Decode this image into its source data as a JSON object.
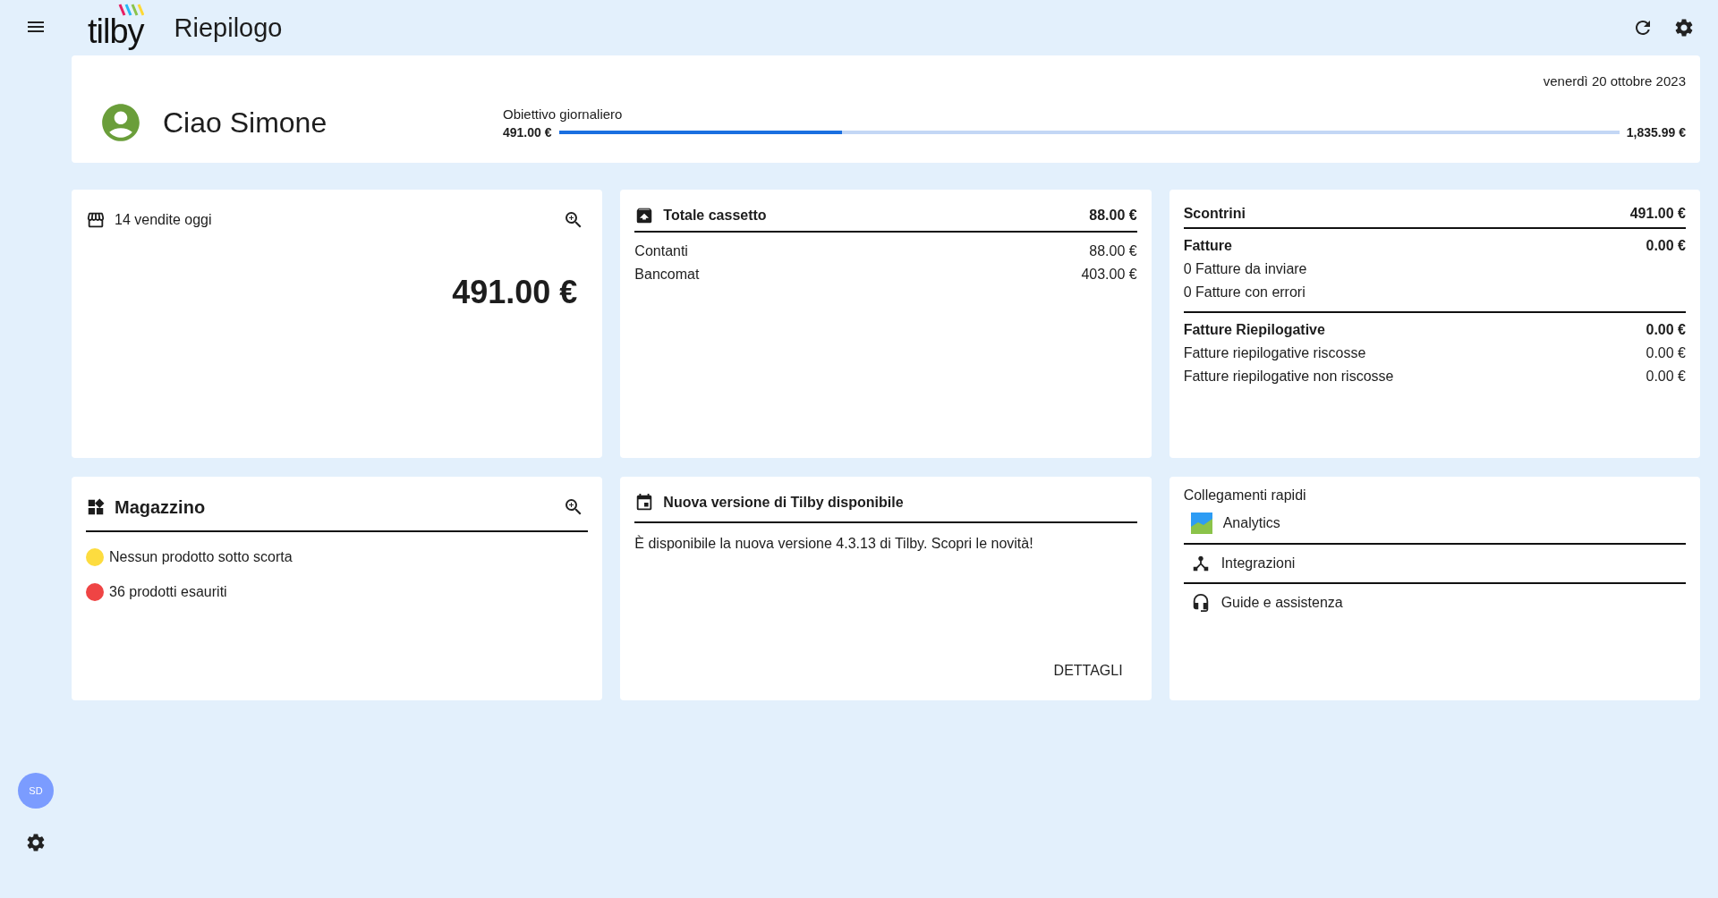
{
  "sidebar": {
    "avatar_initials": "SD"
  },
  "header": {
    "logo": "tilby",
    "title": "Riepilogo"
  },
  "greeting": {
    "date": "venerdì 20 ottobre 2023",
    "text": "Ciao Simone",
    "goal": {
      "label": "Obiettivo giornaliero",
      "current": "491.00 €",
      "target": "1,835.99 €",
      "level": 0.267
    }
  },
  "sales_card": {
    "title": "14 vendite oggi",
    "total": "491.00 €"
  },
  "drawer_card": {
    "title": "Totale cassetto",
    "total": "88.00 €",
    "rows": [
      {
        "label": "Contanti",
        "value": "88.00 €"
      },
      {
        "label": "Bancomat",
        "value": "403.00 €"
      }
    ]
  },
  "documents_card": {
    "sections": [
      {
        "title": "Scontrini",
        "total": "491.00 €"
      },
      {
        "title": "Fatture",
        "total": "0.00 €",
        "rows": [
          {
            "label": "0 Fatture da inviare"
          },
          {
            "label": "0 Fatture con errori"
          }
        ]
      },
      {
        "title": "Fatture Riepilogative",
        "total": "0.00 €",
        "rows": [
          {
            "label": "Fatture riepilogative riscosse",
            "value": "0.00 €"
          },
          {
            "label": "Fatture riepilogative non riscosse",
            "value": "0.00 €"
          }
        ]
      }
    ]
  },
  "warehouse_card": {
    "title": "Magazzino",
    "items": [
      {
        "text": "Nessun prodotto sotto scorta",
        "color": "#fddc3f"
      },
      {
        "text": "36 prodotti esauriti",
        "color": "#ef4444"
      }
    ]
  },
  "news_card": {
    "title": "Nuova versione di Tilby disponibile",
    "body": "È disponibile la nuova versione 4.3.13 di Tilby. Scopri le novità!",
    "action": "DETTAGLI"
  },
  "links_card": {
    "title": "Collegamenti rapidi",
    "links": [
      {
        "label": "Analytics",
        "kind": "analytics"
      },
      {
        "label": "Integrazioni",
        "kind": "integrations"
      },
      {
        "label": "Guide e assistenza",
        "kind": "help"
      }
    ]
  }
}
